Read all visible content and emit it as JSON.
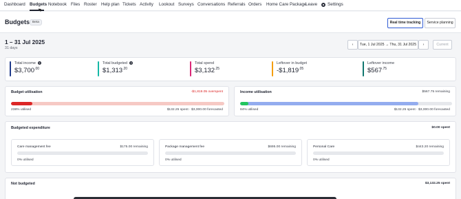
{
  "nav": {
    "items": [
      "Dashboard",
      "Budgets",
      "Notebook",
      "Files",
      "Roster",
      "Help plan",
      "Tickets",
      "Activity",
      "Lookout",
      "Surveys",
      "Conversations",
      "Referrals",
      "Orders",
      "Home Care Package",
      "Leave",
      "Settings"
    ],
    "active": "Budgets"
  },
  "header": {
    "title": "Budgets",
    "badge": "Beta",
    "tabs": [
      "Real time tracking",
      "Service planning"
    ],
    "active_tab": "Real time tracking"
  },
  "period": {
    "range": "1 – 31 Jul 2025",
    "days": "31 days",
    "picker": "Tue, 1 Jul 2025 → Thu, 31 Jul 2025",
    "current": "Current"
  },
  "metrics": [
    {
      "label": "Total income",
      "value": "$3,700",
      "cents": ".00",
      "has_info": true,
      "color": "#1e3a8a"
    },
    {
      "label": "Total budgeted",
      "value": "$1,313",
      "cents": ".20",
      "has_info": true,
      "color": "#14b8a6"
    },
    {
      "label": "Total spend",
      "value": "$3,132",
      "cents": ".25",
      "has_info": false,
      "color": "#db2777"
    },
    {
      "label": "Leftover in budget",
      "value": "-$1,819",
      "cents": ".05",
      "has_info": false,
      "color": "#f59e0b"
    },
    {
      "label": "Leftover income",
      "value": "$567",
      "cents": ".75",
      "has_info": false,
      "color": "#0f766e"
    }
  ],
  "budget_utilisation": {
    "title": "Budget utilisation",
    "status": "-$1,819.05 overspent",
    "utilised": "238% utilised",
    "spent": "$132.25 spent · $3,000.00 forecasted",
    "fill_fraction": 0.1,
    "rest_fraction": 1.0,
    "fill_color": "#dc2626",
    "rest_color": "#f6c9c4"
  },
  "income_utilisation": {
    "title": "Income utilisation",
    "status": "$567.75 remaining",
    "utilised": "84% utilised",
    "spent": "$132.25 spent · $3,000.00 forecasted",
    "fill_fraction": 0.04,
    "rest_fraction": 0.84,
    "fill_color": "#22c55e",
    "rest_color": "#93acef"
  },
  "budgeted_expenditure": {
    "title": "Budgeted expenditure",
    "total": "$0.00 spent",
    "items": [
      {
        "name": "Care management fee",
        "remaining": "$175.00 remaining",
        "utilised": "0% utilised"
      },
      {
        "name": "Package management fee",
        "remaining": "$695.00 remaining",
        "utilised": "0% utilised"
      },
      {
        "name": "Personal Care",
        "remaining": "$443.20 remaining",
        "utilised": "0% utilised"
      }
    ]
  },
  "not_budgeted": {
    "title": "Not budgeted",
    "total": "$3,132.25 spent"
  }
}
